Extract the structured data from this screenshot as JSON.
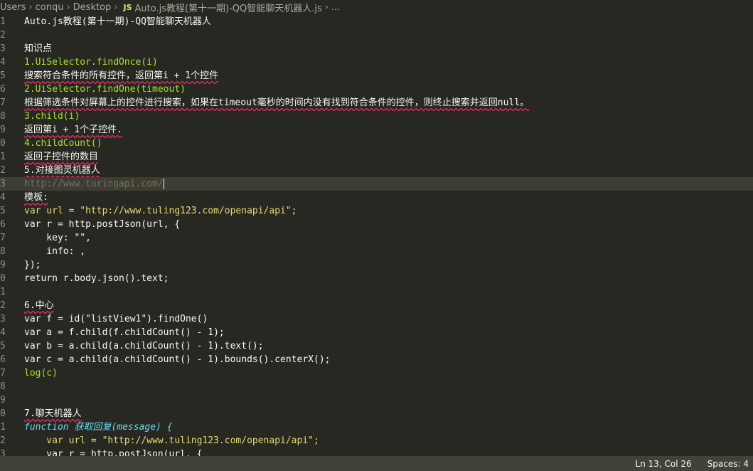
{
  "breadcrumb": {
    "items": [
      "Users",
      "conqu",
      "Desktop",
      "Auto.js教程(第十一期)-QQ智能聊天机器人.js",
      "..."
    ],
    "file_icon": "JS"
  },
  "editor": {
    "line_numbers": [
      "1",
      "2",
      "3",
      "4",
      "5",
      "6",
      "7",
      "8",
      "9",
      "0",
      "1",
      "2",
      "3",
      "4",
      "5",
      "6",
      "7",
      "8",
      "9",
      "0",
      "1",
      "2",
      "3",
      "4",
      "5",
      "6",
      "7",
      "8",
      "9",
      "0",
      "1",
      "2",
      "3"
    ],
    "lines": [
      "Auto.js教程(第十一期)-QQ智能聊天机器人",
      "",
      "知识点",
      "1.UiSelector.findOnce(i)",
      "搜索符合条件的所有控件，返回第i + 1个控件",
      "2.UiSelector.findOne(timeout)",
      "根据筛选条件对屏幕上的控件进行搜索，如果在timeout毫秒的时间内没有找到符合条件的控件，则终止搜索并返回null。",
      "3.child(i)",
      "返回第i + 1个子控件.",
      "4.childCount()",
      "返回子控件的数目",
      "5.对接图灵机器人",
      "http://www.turingapi.com/",
      "模板:",
      "var url = \"http://www.tuling123.com/openapi/api\";",
      "var r = http.postJson(url, {",
      "    key: \"\",",
      "    info: ,",
      "});",
      "return r.body.json().text;",
      "",
      "6.中心",
      "var f = id(\"listView1\").findOne()",
      "var a = f.child(f.childCount() - 1);",
      "var b = a.child(a.childCount() - 1).text();",
      "var c = a.child(a.childCount() - 1).bounds().centerX();",
      "log(c)",
      "",
      "",
      "7.聊天机器人",
      "function 获取回复(message) {",
      "    var url = \"http://www.tuling123.com/openapi/api\";",
      "    var r = http.postJson(url, {"
    ]
  },
  "status": {
    "position": "Ln 13, Col 26",
    "indent": "Spaces: 4"
  }
}
